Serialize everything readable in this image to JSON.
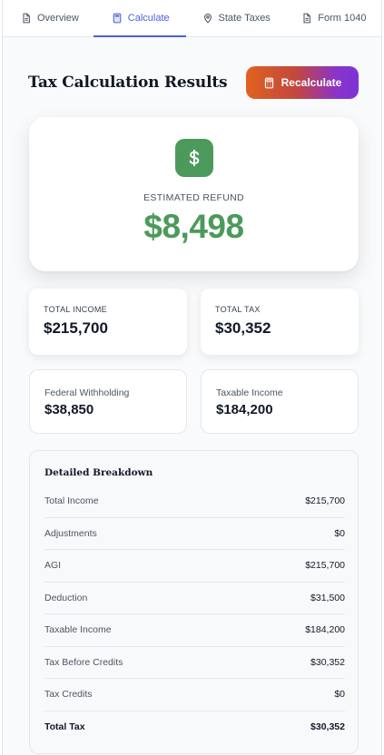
{
  "tabs": [
    {
      "label": "Overview",
      "icon": "document-icon",
      "active": false
    },
    {
      "label": "Calculate",
      "icon": "calculator-icon",
      "active": true
    },
    {
      "label": "State Taxes",
      "icon": "location-pin-icon",
      "active": false
    },
    {
      "label": "Form 1040",
      "icon": "document-icon",
      "active": false
    }
  ],
  "header": {
    "title": "Tax Calculation Results",
    "recalculate_label": "Recalculate"
  },
  "refund": {
    "label": "ESTIMATED REFUND",
    "amount": "$8,498",
    "icon": "dollar-icon"
  },
  "stats": {
    "total_income": {
      "label": "TOTAL INCOME",
      "value": "$215,700"
    },
    "total_tax": {
      "label": "TOTAL TAX",
      "value": "$30,352"
    },
    "federal_withholding": {
      "label": "Federal Withholding",
      "value": "$38,850"
    },
    "taxable_income": {
      "label": "Taxable Income",
      "value": "$184,200"
    }
  },
  "breakdown": {
    "title": "Detailed Breakdown",
    "rows": [
      {
        "label": "Total Income",
        "value": "$215,700"
      },
      {
        "label": "Adjustments",
        "value": "$0"
      },
      {
        "label": "AGI",
        "value": "$215,700"
      },
      {
        "label": "Deduction",
        "value": "$31,500"
      },
      {
        "label": "Taxable Income",
        "value": "$184,200"
      },
      {
        "label": "Tax Before Credits",
        "value": "$30,352"
      },
      {
        "label": "Tax Credits",
        "value": "$0"
      },
      {
        "label": "Total Tax",
        "value": "$30,352"
      }
    ]
  },
  "colors": {
    "accent": "#4f5fd6",
    "refund_green": "#4c9a5b",
    "button_gradient_start": "#e0621f",
    "button_gradient_end": "#7d33d8"
  }
}
